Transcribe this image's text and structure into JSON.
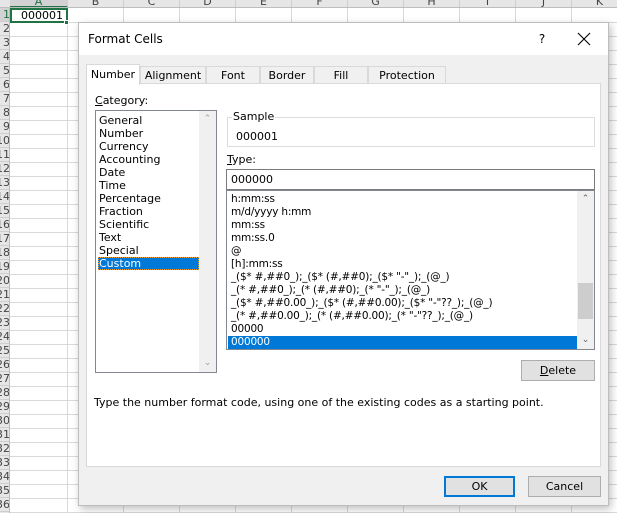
{
  "spreadsheet": {
    "columns": [
      "A",
      "B",
      "C",
      "D",
      "E",
      "F",
      "G",
      "H",
      "I",
      "J",
      "K"
    ],
    "active_column": "A",
    "row_labels": [
      "1",
      "2",
      "3",
      "4",
      "5",
      "6",
      "7",
      "8",
      "9",
      "10",
      "11",
      "12",
      "13",
      "14",
      "15",
      "16",
      "17",
      "18",
      "19",
      "20",
      "21",
      "22",
      "23",
      "24",
      "25",
      "26",
      "27",
      "28",
      "29",
      "30",
      "31",
      "32",
      "33",
      "34",
      "35",
      "36"
    ],
    "active_cell_value": "000001",
    "accent_color": "#217346"
  },
  "dialog": {
    "title": "Format Cells",
    "help_label": "?",
    "tabs": [
      {
        "label": "Number",
        "active": true
      },
      {
        "label": "Alignment",
        "active": false
      },
      {
        "label": "Font",
        "active": false
      },
      {
        "label": "Border",
        "active": false
      },
      {
        "label": "Fill",
        "active": false
      },
      {
        "label": "Protection",
        "active": false
      }
    ],
    "category": {
      "label_accel": "C",
      "label_rest": "ategory:",
      "items": [
        "General",
        "Number",
        "Currency",
        "Accounting",
        "Date",
        "Time",
        "Percentage",
        "Fraction",
        "Scientific",
        "Text",
        "Special",
        "Custom"
      ],
      "selected": "Custom"
    },
    "sample": {
      "legend": "Sample",
      "value": "000001"
    },
    "type": {
      "label_accel": "T",
      "label_rest": "ype:",
      "value": "000000",
      "items": [
        "h:mm:ss",
        "m/d/yyyy h:mm",
        "mm:ss",
        "mm:ss.0",
        "@",
        "[h]:mm:ss",
        "_($* #,##0_);_($* (#,##0);_($* \"-\"_);_(@_)",
        "_(* #,##0_);_(* (#,##0);_(* \"-\"_);_(@_)",
        "_($* #,##0.00_);_($* (#,##0.00);_($* \"-\"??_);_(@_)",
        "_(* #,##0.00_);_(* (#,##0.00);_(* \"-\"??_);_(@_)",
        "00000",
        "000000"
      ],
      "selected": "000000",
      "scroll_position_fraction": 0.85
    },
    "delete_accel": "D",
    "delete_rest": "elete",
    "hint": "Type the number format code, using one of the existing codes as a starting point.",
    "ok_label": "OK",
    "cancel_label": "Cancel",
    "selection_color": "#0078d7"
  }
}
